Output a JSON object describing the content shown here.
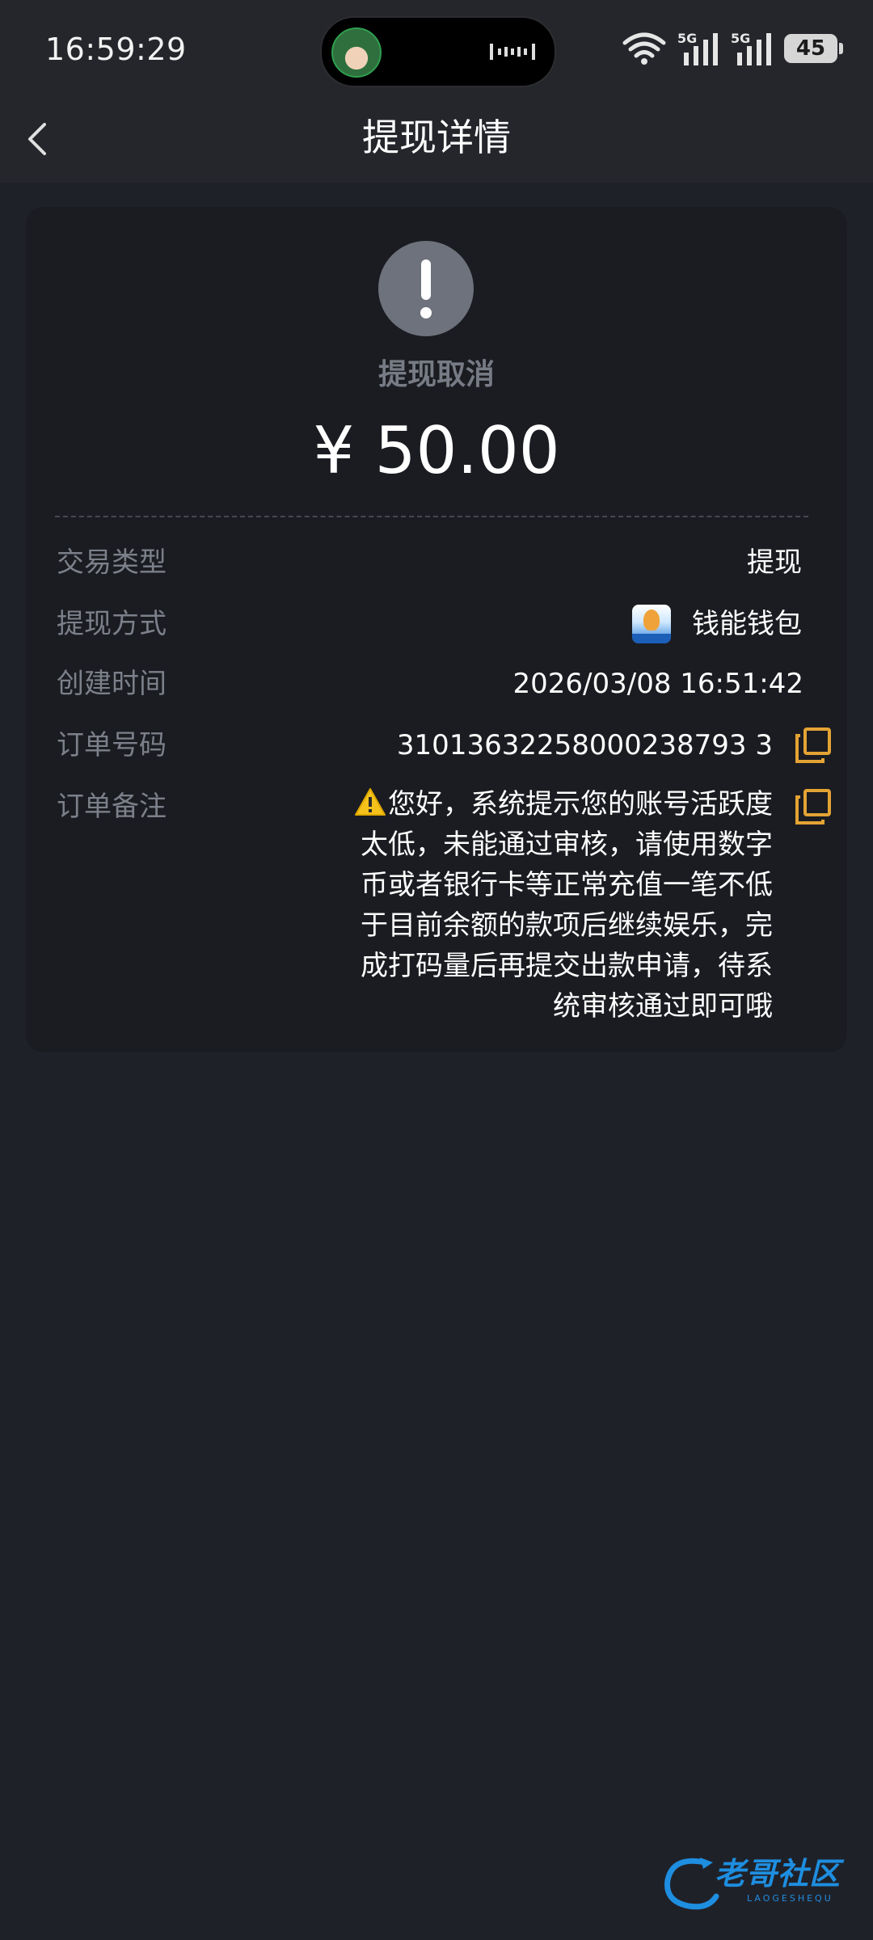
{
  "status_bar": {
    "time": "16:59:29",
    "network_1": "5G",
    "network_2": "5G",
    "battery": "45"
  },
  "nav": {
    "title": "提现详情",
    "back_icon": "chevron-left-icon"
  },
  "summary": {
    "status_icon": "exclamation-icon",
    "status_text": "提现取消",
    "amount": "¥ 50.00"
  },
  "details": {
    "type": {
      "label": "交易类型",
      "value": "提现"
    },
    "method": {
      "label": "提现方式",
      "value": "钱能钱包",
      "icon": "wallet-app-icon"
    },
    "created": {
      "label": "创建时间",
      "value": "2026/03/08 16:51:42"
    },
    "order_no": {
      "label": "订单号码",
      "value": "31013632258000238793 3"
    },
    "remark": {
      "label": "订单备注",
      "warning_icon": "warning-icon",
      "value": "您好，系统提示您的账号活跃度太低，未能通过审核，请使用数字币或者银行卡等正常充值一笔不低于目前余额的款项后继续娱乐，完成打码量后再提交出款申请，待系统审核通过即可哦"
    }
  },
  "colors": {
    "background": "#1f2129",
    "card": "#1b1c21",
    "copy_icon": "#e3a334",
    "muted": "#7b808a"
  },
  "watermark": {
    "text": "老哥社区",
    "sub": "LAOGESHEQU"
  }
}
